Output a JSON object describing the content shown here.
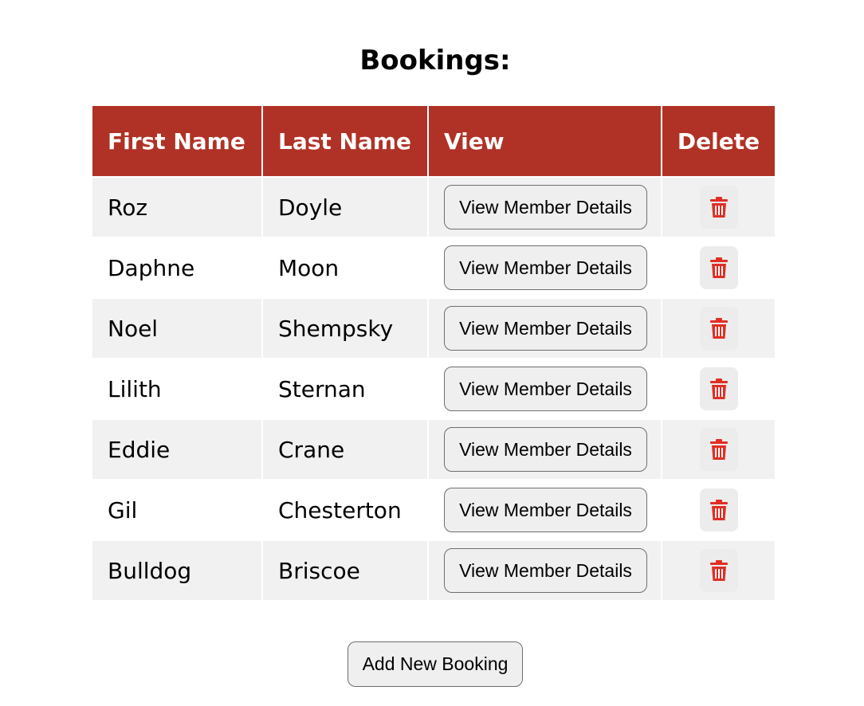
{
  "page": {
    "title": "Bookings:"
  },
  "table": {
    "headers": {
      "first_name": "First Name",
      "last_name": "Last Name",
      "view": "View",
      "delete": "Delete"
    },
    "rows": [
      {
        "first_name": "Roz",
        "last_name": "Doyle",
        "view_label": "View Member Details"
      },
      {
        "first_name": "Daphne",
        "last_name": "Moon",
        "view_label": "View Member Details"
      },
      {
        "first_name": "Noel",
        "last_name": "Shempsky",
        "view_label": "View Member Details"
      },
      {
        "first_name": "Lilith",
        "last_name": "Sternan",
        "view_label": "View Member Details"
      },
      {
        "first_name": "Eddie",
        "last_name": "Crane",
        "view_label": "View Member Details"
      },
      {
        "first_name": "Gil",
        "last_name": "Chesterton",
        "view_label": "View Member Details"
      },
      {
        "first_name": "Bulldog",
        "last_name": "Briscoe",
        "view_label": "View Member Details"
      }
    ],
    "delete_icon": "trash-icon"
  },
  "actions": {
    "add_label": "Add New Booking"
  },
  "colors": {
    "header_bg": "#b03226",
    "header_text": "#ffffff",
    "row_alt_bg": "#f1f1f1",
    "delete_icon": "#e02e24"
  }
}
